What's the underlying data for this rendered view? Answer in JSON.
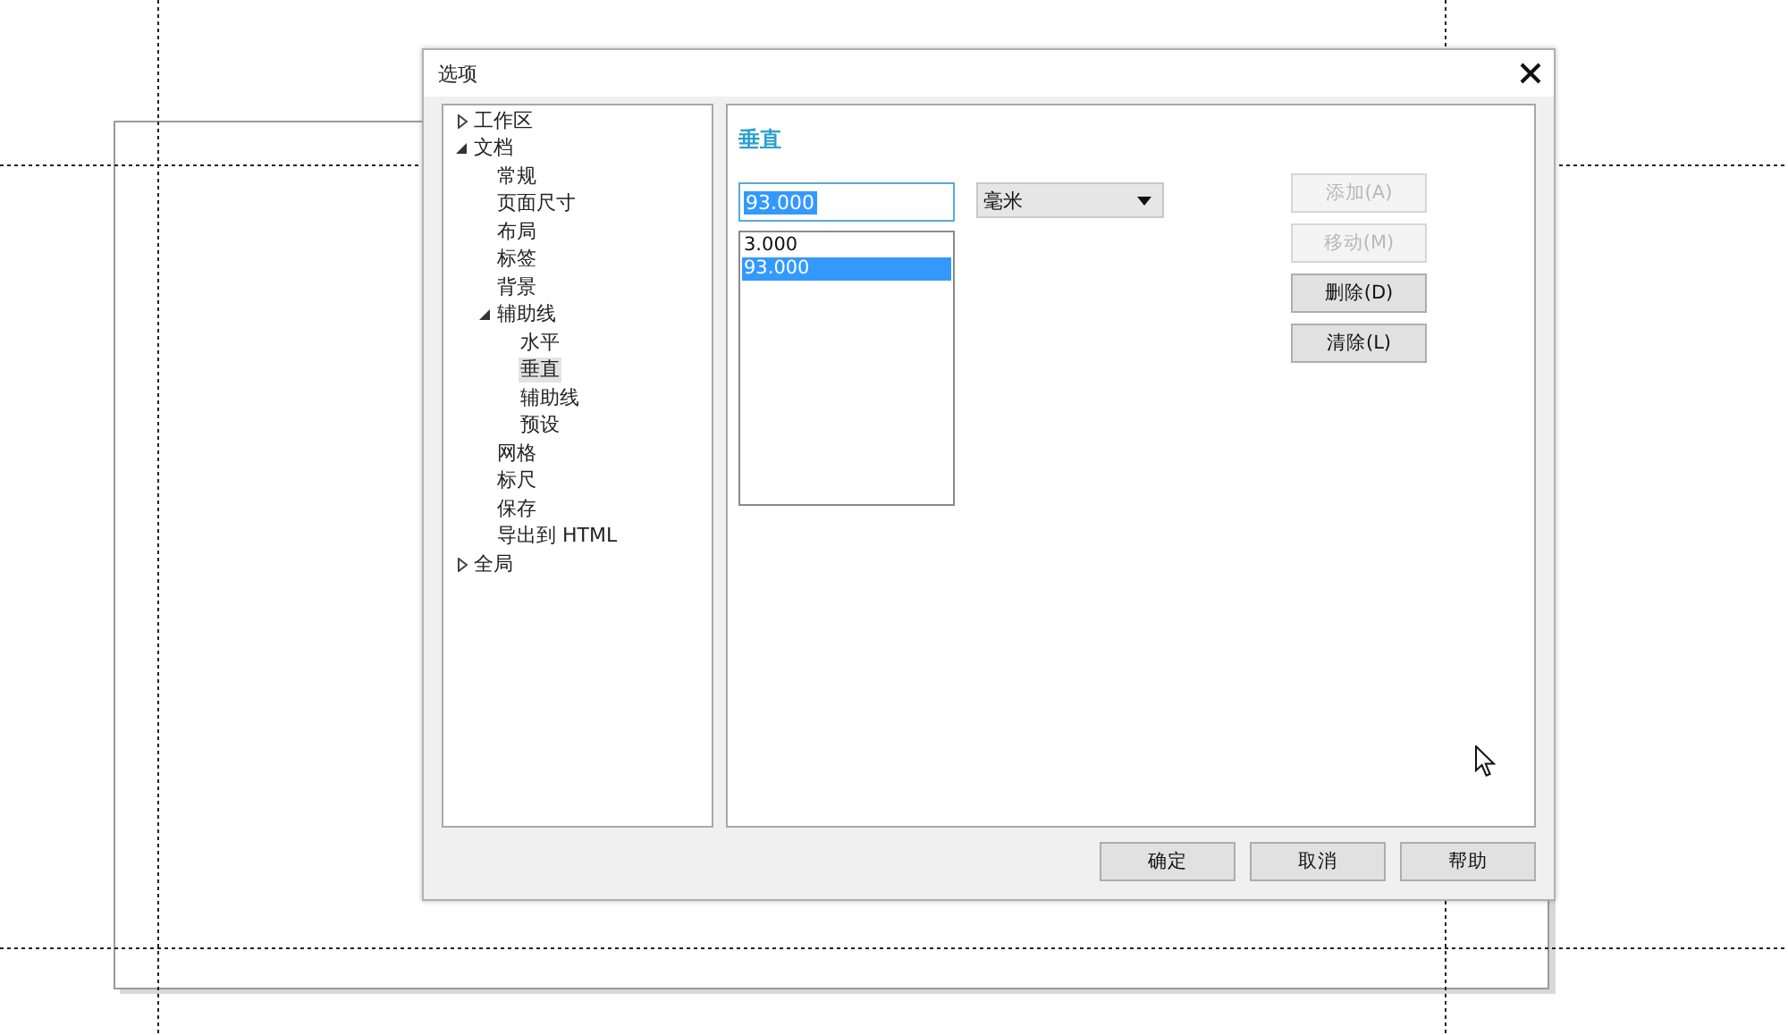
{
  "window": {
    "title": "选项"
  },
  "tree": [
    {
      "label": "工作区",
      "expanded": false,
      "selected": false
    },
    {
      "label": "文档",
      "expanded": true,
      "selected": false,
      "children": [
        {
          "label": "常规",
          "selected": false
        },
        {
          "label": "页面尺寸",
          "selected": false
        },
        {
          "label": "布局",
          "selected": false
        },
        {
          "label": "标签",
          "selected": false
        },
        {
          "label": "背景",
          "selected": false
        },
        {
          "label": "辅助线",
          "expanded": true,
          "selected": false,
          "children": [
            {
              "label": "水平",
              "selected": false
            },
            {
              "label": "垂直",
              "selected": true
            },
            {
              "label": "辅助线",
              "selected": false
            },
            {
              "label": "预设",
              "selected": false
            }
          ]
        },
        {
          "label": "网格",
          "selected": false
        },
        {
          "label": "标尺",
          "selected": false
        },
        {
          "label": "保存",
          "selected": false
        },
        {
          "label": "导出到 HTML",
          "selected": false
        }
      ]
    },
    {
      "label": "全局",
      "expanded": false,
      "selected": false
    }
  ],
  "panel": {
    "heading": "垂直",
    "value_field": {
      "value": "93.000",
      "text_selected": true
    },
    "unit_dropdown": {
      "value": "毫米"
    },
    "guides_list": [
      {
        "label": "3.000",
        "selected": false
      },
      {
        "label": "93.000",
        "selected": true
      }
    ],
    "side_buttons": [
      {
        "label": "添加(A)",
        "disabled": true
      },
      {
        "label": "移动(M)",
        "disabled": true
      },
      {
        "label": "删除(D)",
        "disabled": false
      },
      {
        "label": "清除(L)",
        "disabled": false
      }
    ]
  },
  "buttons": [
    "确定",
    "取消",
    "帮助"
  ]
}
